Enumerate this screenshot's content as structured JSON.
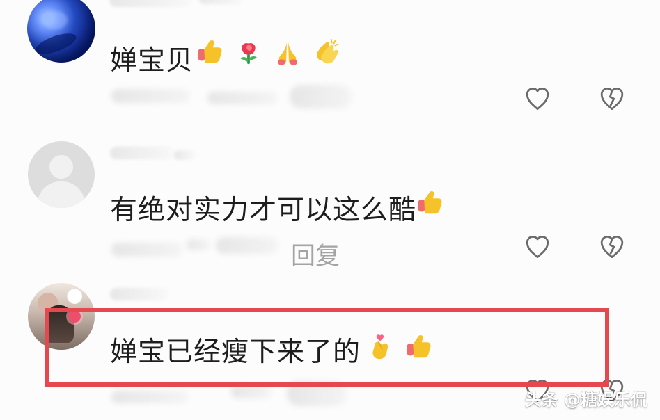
{
  "comments": [
    {
      "text": "婵宝贝",
      "emojis": [
        "thumbs-up-icon",
        "rose-icon",
        "pray-hands-icon",
        "clapping-hands-icon"
      ]
    },
    {
      "text": "有绝对实力才可以这么酷",
      "emojis": [
        "thumbs-up-icon"
      ],
      "reply_text": "回复"
    },
    {
      "text": "婵宝已经瘦下来了的",
      "emojis": [
        "finger-heart-icon",
        "thumbs-up-icon"
      ]
    }
  ],
  "watermark": "头条 @糖娱乐侃",
  "colors": {
    "highlight": "#e5484f",
    "text": "#1d1d1d",
    "muted": "#a4a4a4",
    "icon": "#6b6b6b",
    "emoji_yellow": "#f6c229",
    "emoji_red": "#f06b6b"
  }
}
